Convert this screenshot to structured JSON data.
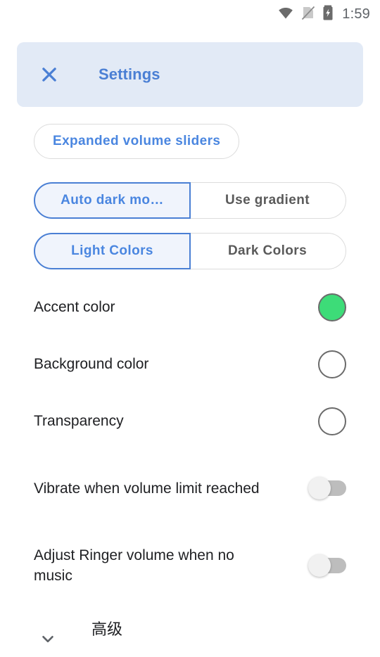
{
  "statusbar": {
    "wifi_icon": "wifi-icon",
    "sim_icon": "sim-card-off-icon",
    "battery_icon": "battery-charging-icon",
    "clock": "1:59"
  },
  "header": {
    "close_icon": "close-icon",
    "title": "Settings"
  },
  "buttons": {
    "expanded_volume_sliders": "Expanded volume sliders"
  },
  "segmented": [
    {
      "name": "dark-mode",
      "options": [
        {
          "label": "Auto dark mo…",
          "selected": true
        },
        {
          "label": "Use gradient",
          "selected": false
        }
      ]
    },
    {
      "name": "color-scheme",
      "options": [
        {
          "label": "Light Colors",
          "selected": true
        },
        {
          "label": "Dark Colors",
          "selected": false
        }
      ]
    }
  ],
  "settings": [
    {
      "label": "Accent color",
      "control": "swatch",
      "color": "#3ddc78"
    },
    {
      "label": "Background color",
      "control": "swatch",
      "color": "#ffffff"
    },
    {
      "label": "Transparency",
      "control": "swatch",
      "color": "#ffffff"
    },
    {
      "label": "Vibrate when volume limit reached",
      "control": "switch",
      "value": "off"
    },
    {
      "label": "Adjust Ringer volume when no music",
      "control": "switch",
      "value": "off"
    }
  ],
  "advanced": {
    "chevron_icon": "chevron-down-icon",
    "title": "高级",
    "subtitle": ""
  },
  "colors": {
    "accent_blue": "#4a7fd4",
    "header_bg": "#e2eaf6",
    "selected_seg_bg": "#f0f4fc",
    "accent_green": "#3ddc78"
  }
}
